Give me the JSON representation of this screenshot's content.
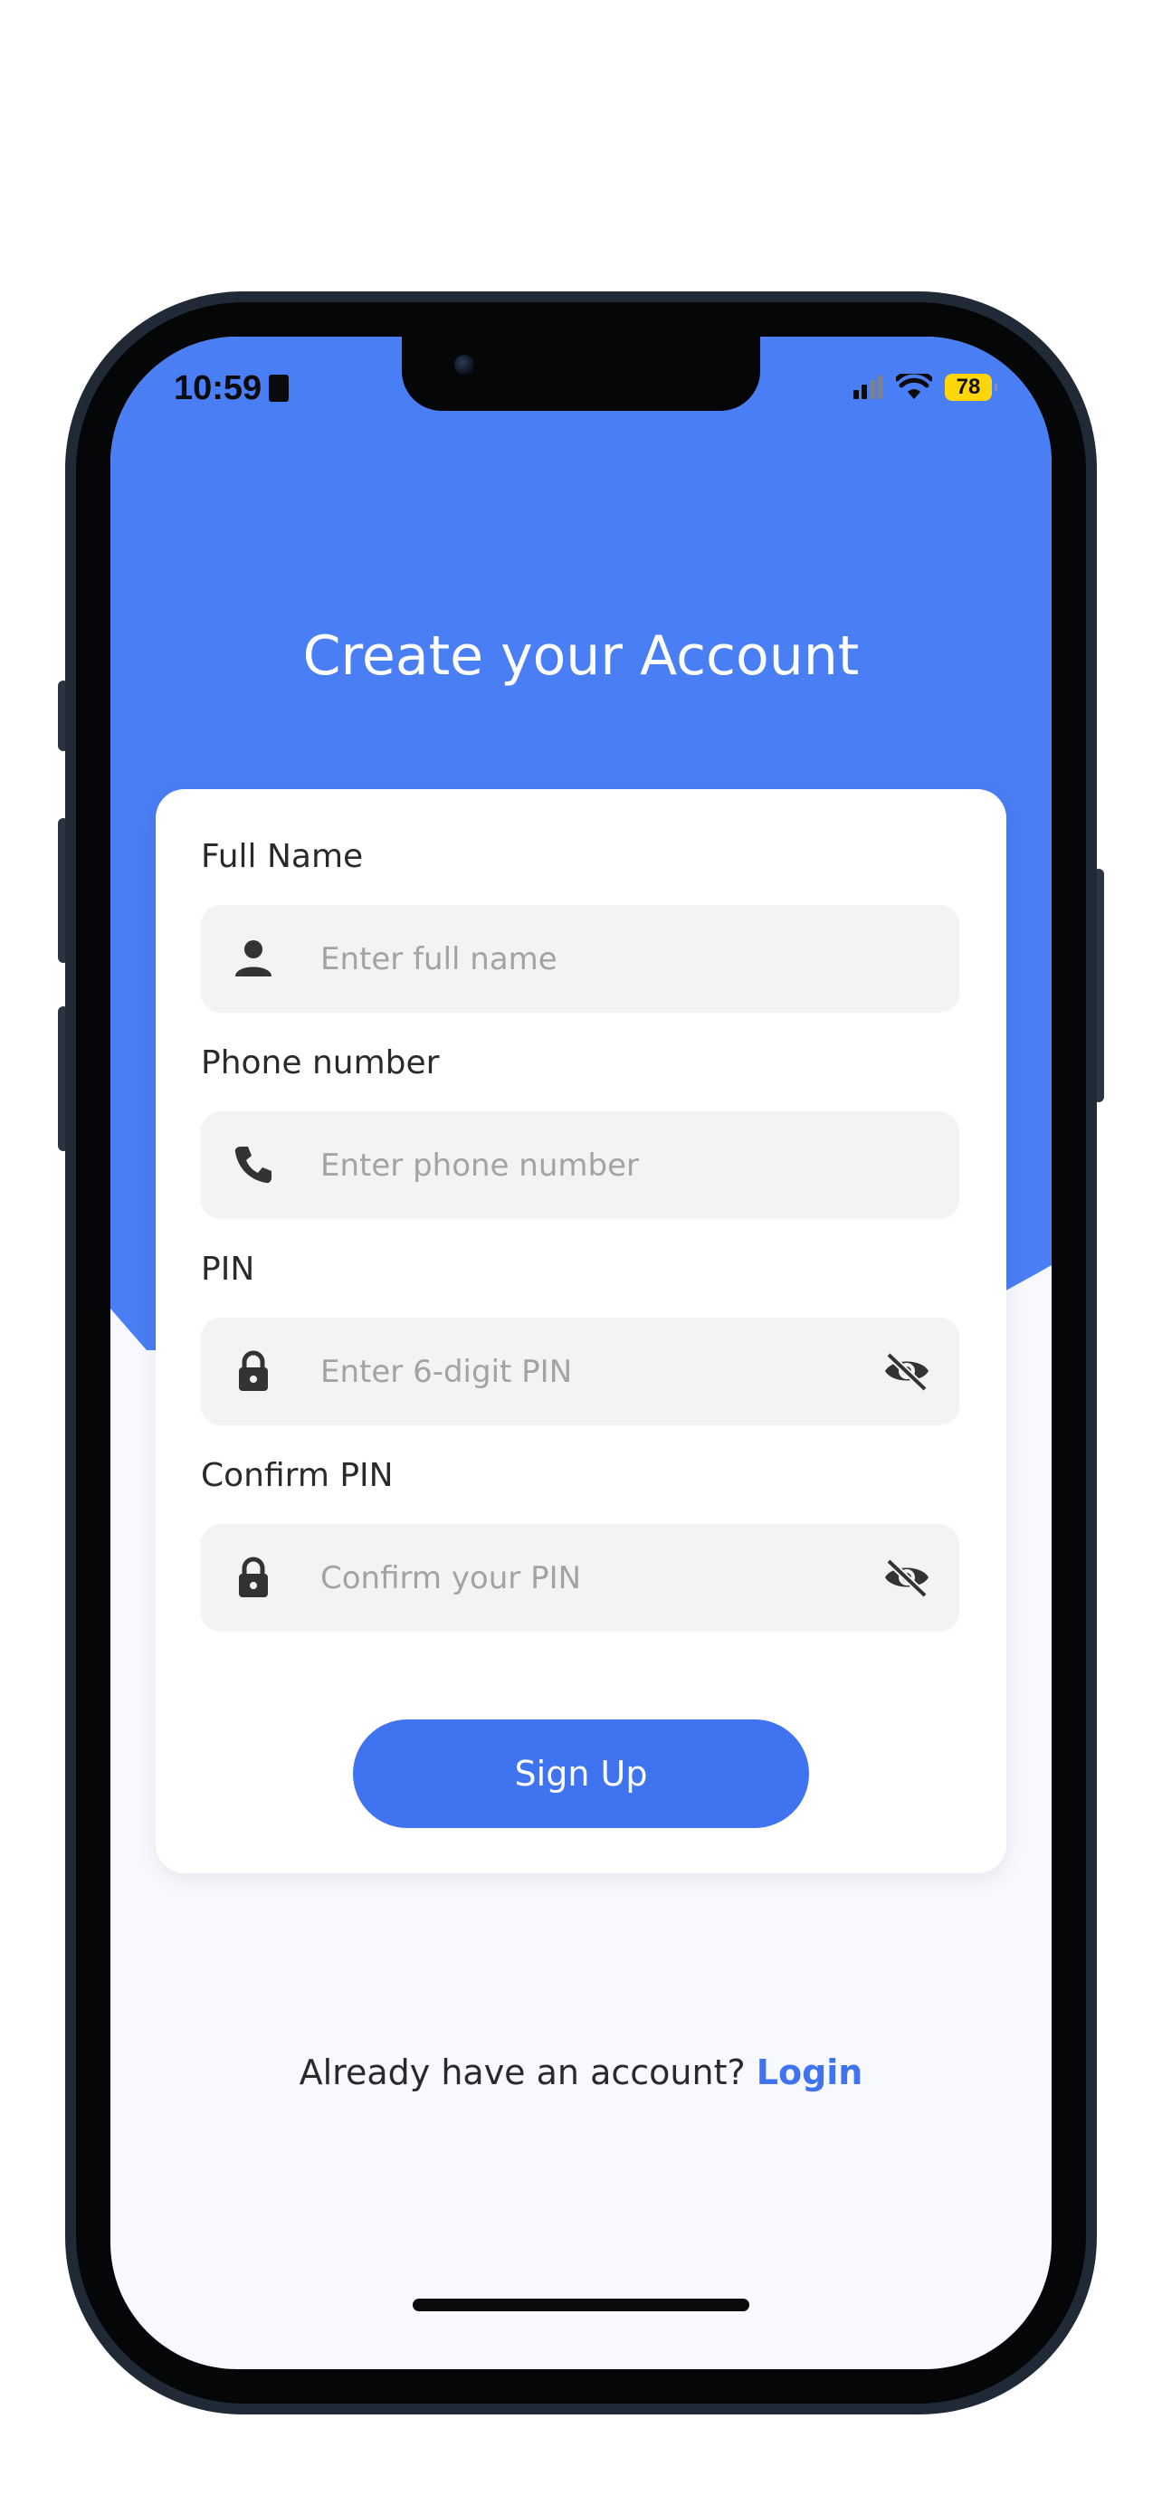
{
  "status_bar": {
    "time": "10:59",
    "battery": "78"
  },
  "header": {
    "title": "Create your Account"
  },
  "form": {
    "full_name": {
      "label": "Full Name",
      "placeholder": "Enter full name",
      "icon": "person-icon"
    },
    "phone": {
      "label": "Phone number",
      "placeholder": "Enter phone number",
      "icon": "phone-icon"
    },
    "pin": {
      "label": "PIN",
      "placeholder": "Enter 6-digit PIN",
      "icon": "lock-icon",
      "toggle_icon": "eye-off-icon"
    },
    "confirm_pin": {
      "label": "Confirm PIN",
      "placeholder": "Confirm your PIN",
      "icon": "lock-icon",
      "toggle_icon": "eye-off-icon"
    },
    "submit_label": "Sign Up"
  },
  "footer": {
    "prompt": "Already have an account?",
    "link_label": "Login"
  },
  "colors": {
    "primary": "#4a7ef5",
    "button": "#3f73f0",
    "background": "#f7f9ff",
    "field_bg": "#f3f3f3"
  }
}
